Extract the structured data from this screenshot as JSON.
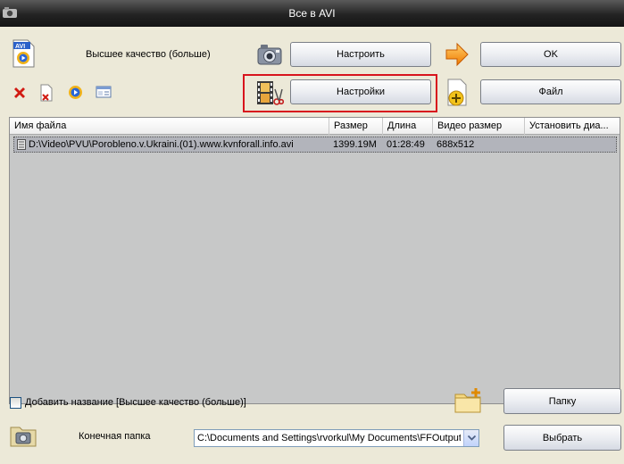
{
  "window": {
    "title": "Все в AVI"
  },
  "toolbar": {
    "quality_label": "Высшее качество (больше)",
    "configure_label": "Настроить",
    "settings_label": "Настройки",
    "ok_label": "OK",
    "file_label": "Файл"
  },
  "file_list": {
    "columns": [
      "Имя файла",
      "Размер",
      "Длина",
      "Видео размер",
      "Установить диа..."
    ],
    "rows": [
      {
        "name": "D:\\Video\\PVU\\Poroblenо.v.Ukraini.(01).www.kvnforall.info.avi",
        "size": "1399.19M",
        "duration": "01:28:49",
        "video_size": "688x512",
        "range": ""
      }
    ]
  },
  "bottom": {
    "add_title_label": "Добавить название [Высшее качество (больше)]",
    "add_title_checked": false,
    "folder_button_label": "Папку",
    "output_folder_label": "Конечная папка",
    "output_folder_value": "C:\\Documents and Settings\\rvorkul\\My Documents\\FFOutput",
    "choose_button_label": "Выбрать"
  },
  "colors": {
    "highlight": "#d8141d",
    "titlebar": "#232323",
    "list_bg": "#c7c8c8"
  }
}
